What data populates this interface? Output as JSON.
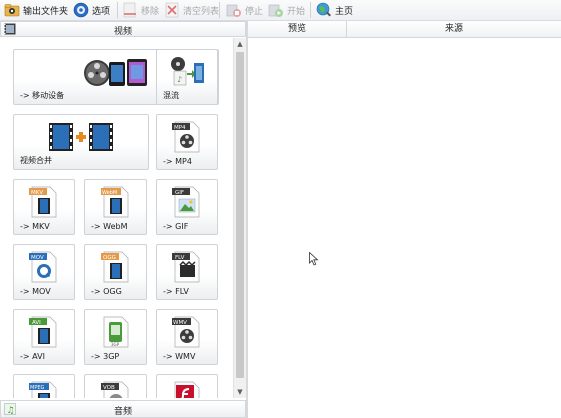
{
  "toolbar": {
    "output_folder": "输出文件夹",
    "options": "选项",
    "remove": "移除",
    "clear_list": "清空列表",
    "stop": "停止",
    "start": "开始",
    "home": "主页"
  },
  "categories": {
    "video": "视频",
    "audio": "音频"
  },
  "tiles": [
    {
      "name": "tile-mobile-device",
      "label": "-> 移动设备",
      "icon": "mobile-device-icon"
    },
    {
      "name": "tile-mix",
      "label": "混流",
      "icon": "mix-icon"
    },
    {
      "name": "tile-video-join",
      "label": "视频合并",
      "icon": "video-join-icon"
    },
    {
      "name": "tile-mp4",
      "label": "-> MP4",
      "icon": "mp4-icon",
      "badge": "MP4"
    },
    {
      "name": "tile-mkv",
      "label": "-> MKV",
      "icon": "mkv-icon",
      "badge": "MKV"
    },
    {
      "name": "tile-webm",
      "label": "-> WebM",
      "icon": "webm-icon",
      "badge": "WebM"
    },
    {
      "name": "tile-gif",
      "label": "-> GIF",
      "icon": "gif-icon",
      "badge": "GIF"
    },
    {
      "name": "tile-mov",
      "label": "-> MOV",
      "icon": "mov-icon",
      "badge": "MOV"
    },
    {
      "name": "tile-ogg",
      "label": "-> OGG",
      "icon": "ogg-icon",
      "badge": "OGG"
    },
    {
      "name": "tile-flv",
      "label": "-> FLV",
      "icon": "flv-icon",
      "badge": "FLV"
    },
    {
      "name": "tile-avi",
      "label": "-> AVI",
      "icon": "avi-icon",
      "badge": "AVI"
    },
    {
      "name": "tile-3gp",
      "label": "-> 3GP",
      "icon": "3gp-icon",
      "badge": "3GP"
    },
    {
      "name": "tile-wmv",
      "label": "-> WMV",
      "icon": "wmv-icon",
      "badge": "WMV"
    },
    {
      "name": "tile-mpeg",
      "label": "",
      "icon": "mpeg-icon",
      "badge": "MPEG"
    },
    {
      "name": "tile-vob",
      "label": "",
      "icon": "vob-icon",
      "badge": "VOB"
    },
    {
      "name": "tile-swf",
      "label": "",
      "icon": "swf-icon",
      "badge": ""
    }
  ],
  "list": {
    "col_preview": "预览",
    "col_source": "来源"
  },
  "colors": {
    "film_blue": "#2a6fb8",
    "badge_orange": "#e39b4b",
    "badge_dark": "#3b3b3b",
    "accent_green": "#4a9a3c"
  }
}
